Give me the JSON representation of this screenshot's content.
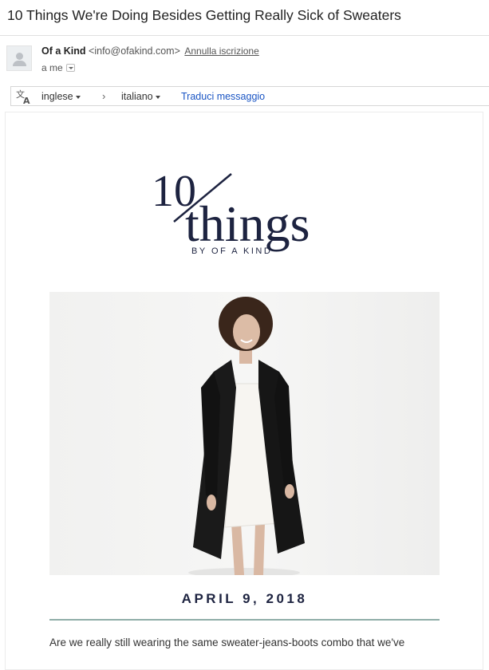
{
  "email": {
    "subject": "10 Things We're Doing Besides Getting Really Sick of Sweaters",
    "sender_name": "Of a Kind",
    "sender_email": "<info@ofakind.com>",
    "unsubscribe_label": "Annulla iscrizione",
    "to_label": "a me"
  },
  "translate_bar": {
    "source_language": "inglese",
    "target_language": "italiano",
    "translate_link": "Traduci messaggio",
    "icon": "translate-icon"
  },
  "newsletter": {
    "logo_number": "10",
    "logo_word": "things",
    "logo_tagline": "BY OF A KIND",
    "hero_image": "woman in black coat and white slip dress",
    "date": "APRIL 9, 2018",
    "body_intro": "Are we really still wearing the same sweater-jeans-boots combo that we've",
    "colors": {
      "navy": "#1d2340",
      "rule": "#8fada8",
      "link": "#1a55c4"
    }
  }
}
